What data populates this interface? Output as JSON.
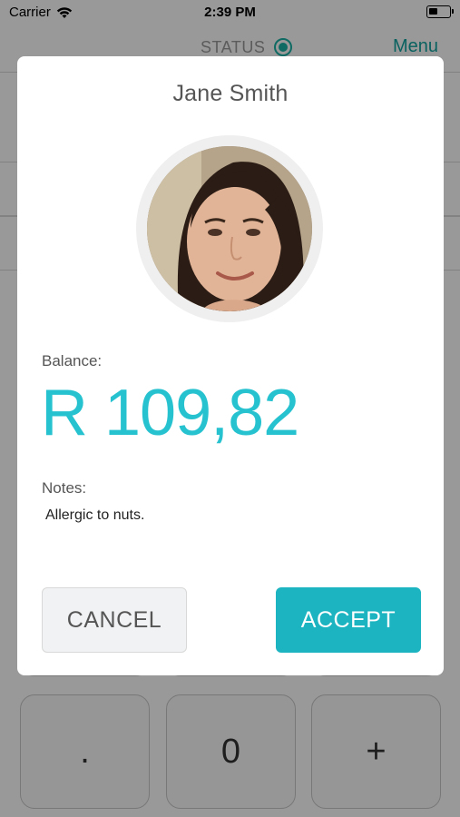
{
  "status_bar": {
    "carrier": "Carrier",
    "time": "2:39 PM"
  },
  "nav": {
    "status_label": "STATUS",
    "menu_label": "Menu"
  },
  "keypad": {
    "dot": ".",
    "zero": "0",
    "plus": "+"
  },
  "modal": {
    "name": "Jane Smith",
    "balance_label": "Balance:",
    "balance_value": "R 109,82",
    "notes_label": "Notes:",
    "notes_value": "Allergic to nuts.",
    "cancel_label": "CANCEL",
    "accept_label": "ACCEPT"
  },
  "colors": {
    "accent": "#1bb4c0",
    "balance": "#26c2d0",
    "status_online": "#1ab1a5"
  }
}
